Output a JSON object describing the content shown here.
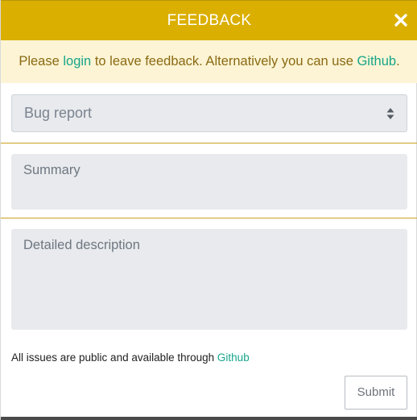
{
  "header": {
    "title": "FEEDBACK",
    "close_icon": "close-icon",
    "color": "#dbaf00"
  },
  "notice": {
    "prefix": "Please ",
    "login_link": "login",
    "middle": " to leave feedback. Alternatively you can use ",
    "github_link": "Github",
    "suffix": "."
  },
  "form": {
    "type_select": {
      "selected": "Bug report",
      "icon": "sort-arrows-icon"
    },
    "summary_placeholder": "Summary",
    "description_placeholder": "Detailed description",
    "footnote_text": "All issues are public and available through ",
    "footnote_link": "Github",
    "submit_label": "Submit"
  },
  "colors": {
    "accent": "#dbaf00",
    "link": "#17a58a",
    "notice_bg": "#fcf4d4"
  }
}
